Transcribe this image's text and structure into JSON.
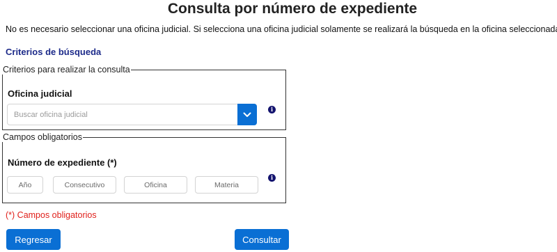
{
  "page": {
    "title": "Consulta por número de expediente",
    "intro": "No es necesario seleccionar una oficina judicial. Si selecciona una oficina judicial solamente se realizará la búsqueda en la oficina seleccionada.",
    "section_heading": "Criterios de búsqueda"
  },
  "criteria": {
    "legend": "Criterios para realizar la consulta",
    "office_label": "Oficina judicial",
    "office_placeholder": "Buscar oficina judicial",
    "office_value": "",
    "dropdown_icon": "chevron-down-icon",
    "info_icon": "info-icon"
  },
  "required": {
    "legend": "Campos obligatorios",
    "case_label": "Número de expediente (*)",
    "fields": [
      {
        "placeholder": "Año",
        "value": ""
      },
      {
        "placeholder": "Consecutivo",
        "value": ""
      },
      {
        "placeholder": "Oficina",
        "value": ""
      },
      {
        "placeholder": "Materia",
        "value": ""
      }
    ],
    "info_icon": "info-icon"
  },
  "required_note": "(*) Campos obligatorios",
  "buttons": {
    "back": "Regresar",
    "submit": "Consultar"
  },
  "colors": {
    "primary": "#0a6fd4",
    "heading": "#1d2b8a",
    "required": "#e0201b",
    "info_icon": "#13136e"
  }
}
